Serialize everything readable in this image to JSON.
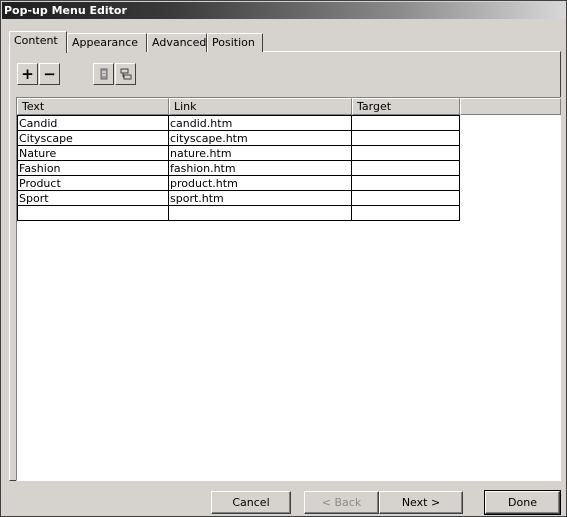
{
  "window": {
    "title": "Pop-up Menu Editor"
  },
  "tabs": [
    {
      "label": "Content",
      "active": true
    },
    {
      "label": "Appearance",
      "active": false
    },
    {
      "label": "Advanced",
      "active": false
    },
    {
      "label": "Position",
      "active": false
    }
  ],
  "toolbar": {
    "add_label": "+",
    "remove_label": "−",
    "icons": [
      "indent-icon",
      "outdent-icon"
    ]
  },
  "grid": {
    "columns": [
      "Text",
      "Link",
      "Target"
    ],
    "rows": [
      [
        "Candid",
        "candid.htm",
        ""
      ],
      [
        "Cityscape",
        "cityscape.htm",
        ""
      ],
      [
        "Nature",
        "nature.htm",
        ""
      ],
      [
        "Fashion",
        "fashion.htm",
        ""
      ],
      [
        "Product",
        "product.htm",
        ""
      ],
      [
        "Sport",
        "sport.htm",
        ""
      ],
      [
        "",
        "",
        ""
      ]
    ]
  },
  "buttons": {
    "cancel": "Cancel",
    "back": "< Back",
    "next": "Next >",
    "done": "Done"
  }
}
